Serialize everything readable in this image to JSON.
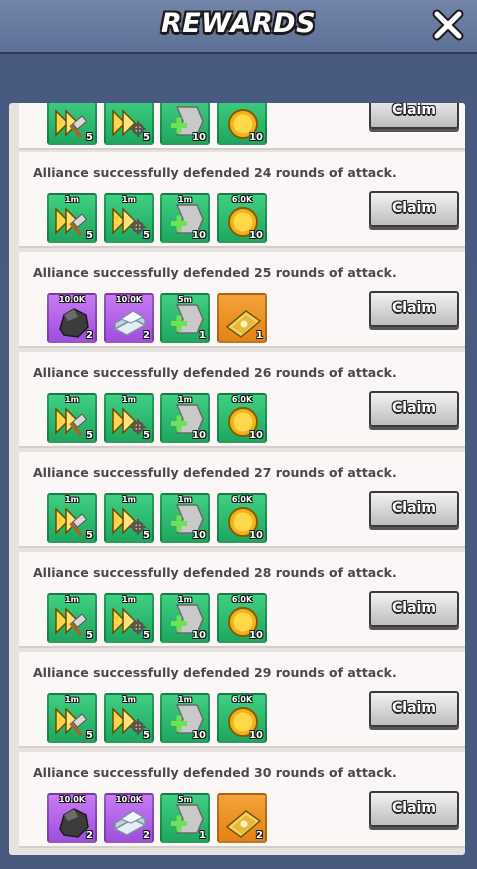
{
  "header": {
    "title": "REWARDS"
  },
  "claim_label": "Claim",
  "rows": [
    {
      "text": "",
      "items": [
        {
          "kind": "speedup-build",
          "color": "green",
          "top": "",
          "qty": "5"
        },
        {
          "kind": "speedup-research",
          "color": "green",
          "top": "",
          "qty": "5"
        },
        {
          "kind": "speedup-heal",
          "color": "green",
          "top": "",
          "qty": "10"
        },
        {
          "kind": "gold",
          "color": "green",
          "top": "",
          "qty": "10"
        }
      ]
    },
    {
      "text": "Alliance successfully defended 24 rounds of attack.",
      "items": [
        {
          "kind": "speedup-build",
          "color": "green",
          "top": "1m",
          "qty": "5"
        },
        {
          "kind": "speedup-research",
          "color": "green",
          "top": "1m",
          "qty": "5"
        },
        {
          "kind": "speedup-heal",
          "color": "green",
          "top": "1m",
          "qty": "10"
        },
        {
          "kind": "gold",
          "color": "green",
          "top": "6.0K",
          "qty": "10"
        }
      ]
    },
    {
      "text": "Alliance successfully defended 25 rounds of attack.",
      "items": [
        {
          "kind": "ore",
          "color": "purple",
          "top": "10.0K",
          "qty": "2"
        },
        {
          "kind": "iron",
          "color": "purple",
          "top": "10.0K",
          "qty": "2"
        },
        {
          "kind": "speedup-heal",
          "color": "green",
          "top": "5m",
          "qty": "1"
        },
        {
          "kind": "gold-ticket",
          "color": "orange",
          "top": "",
          "qty": "1"
        }
      ]
    },
    {
      "text": "Alliance successfully defended 26 rounds of attack.",
      "items": [
        {
          "kind": "speedup-build",
          "color": "green",
          "top": "1m",
          "qty": "5"
        },
        {
          "kind": "speedup-research",
          "color": "green",
          "top": "1m",
          "qty": "5"
        },
        {
          "kind": "speedup-heal",
          "color": "green",
          "top": "1m",
          "qty": "10"
        },
        {
          "kind": "gold",
          "color": "green",
          "top": "6.0K",
          "qty": "10"
        }
      ]
    },
    {
      "text": "Alliance successfully defended 27 rounds of attack.",
      "items": [
        {
          "kind": "speedup-build",
          "color": "green",
          "top": "1m",
          "qty": "5"
        },
        {
          "kind": "speedup-research",
          "color": "green",
          "top": "1m",
          "qty": "5"
        },
        {
          "kind": "speedup-heal",
          "color": "green",
          "top": "1m",
          "qty": "10"
        },
        {
          "kind": "gold",
          "color": "green",
          "top": "6.0K",
          "qty": "10"
        }
      ]
    },
    {
      "text": "Alliance successfully defended 28 rounds of attack.",
      "items": [
        {
          "kind": "speedup-build",
          "color": "green",
          "top": "1m",
          "qty": "5"
        },
        {
          "kind": "speedup-research",
          "color": "green",
          "top": "1m",
          "qty": "5"
        },
        {
          "kind": "speedup-heal",
          "color": "green",
          "top": "1m",
          "qty": "10"
        },
        {
          "kind": "gold",
          "color": "green",
          "top": "6.0K",
          "qty": "10"
        }
      ]
    },
    {
      "text": "Alliance successfully defended 29 rounds of attack.",
      "items": [
        {
          "kind": "speedup-build",
          "color": "green",
          "top": "1m",
          "qty": "5"
        },
        {
          "kind": "speedup-research",
          "color": "green",
          "top": "1m",
          "qty": "5"
        },
        {
          "kind": "speedup-heal",
          "color": "green",
          "top": "1m",
          "qty": "10"
        },
        {
          "kind": "gold",
          "color": "green",
          "top": "6.0K",
          "qty": "10"
        }
      ]
    },
    {
      "text": "Alliance successfully defended 30 rounds of attack.",
      "items": [
        {
          "kind": "ore",
          "color": "purple",
          "top": "10.0K",
          "qty": "2"
        },
        {
          "kind": "iron",
          "color": "purple",
          "top": "10.0K",
          "qty": "2"
        },
        {
          "kind": "speedup-heal",
          "color": "green",
          "top": "5m",
          "qty": "1"
        },
        {
          "kind": "gold-ticket",
          "color": "orange",
          "top": "",
          "qty": "2"
        }
      ]
    }
  ]
}
